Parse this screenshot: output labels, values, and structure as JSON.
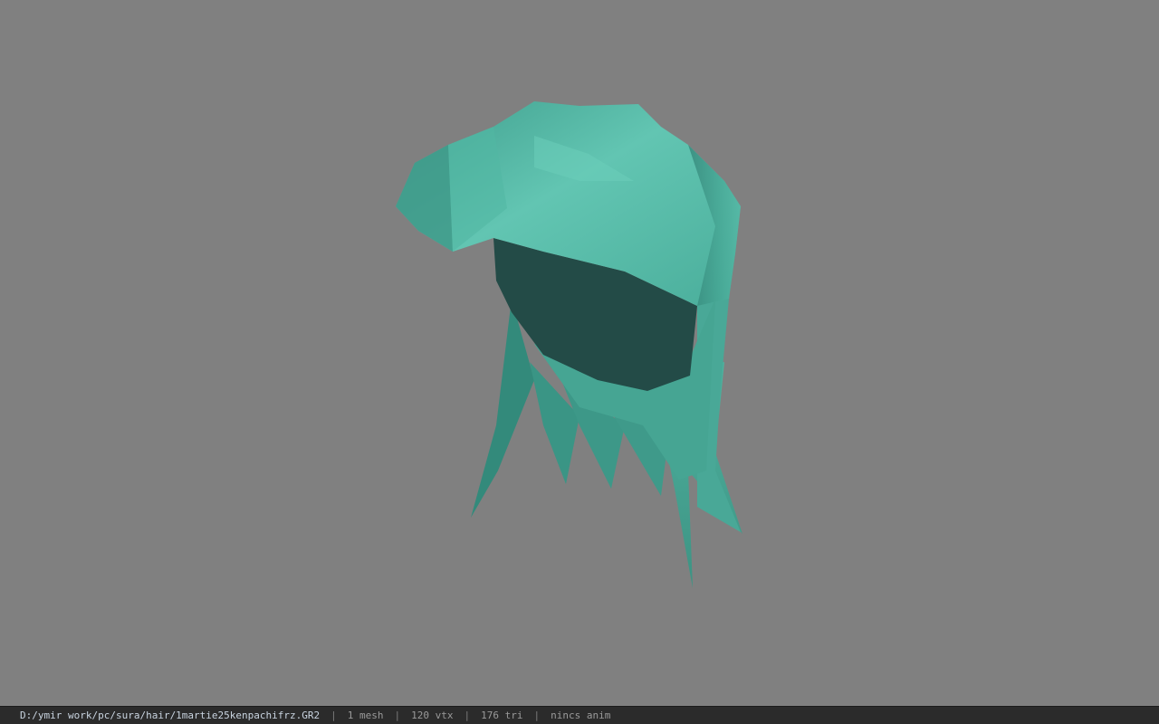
{
  "viewer": {
    "background_color": "#808080",
    "model_color": "#4fb6a2",
    "model_shadow_color": "#234b47"
  },
  "status": {
    "file_path": "D:/ymir work/pc/sura/hair/1martie25kenpachifrz.GR2",
    "separator": "|",
    "mesh_count": "1 mesh",
    "vertex_count": "120 vtx",
    "triangle_count": "176 tri",
    "anim_status": "nincs anim"
  }
}
